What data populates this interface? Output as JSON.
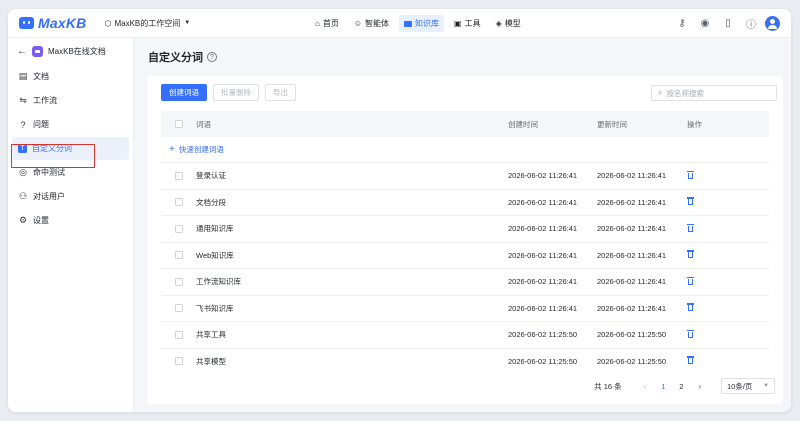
{
  "app": {
    "name": "MaxKB"
  },
  "workspace": {
    "label": "MaxKB的工作空间"
  },
  "nav": [
    {
      "label": "首页",
      "icon": "home-icon",
      "active": false
    },
    {
      "label": "智能体",
      "icon": "robot-icon",
      "active": false
    },
    {
      "label": "知识库",
      "icon": "book-icon",
      "active": true
    },
    {
      "label": "工具",
      "icon": "toolbox-icon",
      "active": false
    },
    {
      "label": "模型",
      "icon": "cube-icon",
      "active": false
    }
  ],
  "top_icons": [
    "key-icon",
    "github-icon",
    "document-icon",
    "help-icon",
    "user-avatar-icon"
  ],
  "sidebar": {
    "kb_name": "MaxKB在线文档",
    "items": [
      {
        "label": "文档",
        "icon": "document-icon",
        "active": false
      },
      {
        "label": "工作流",
        "icon": "workflow-icon",
        "active": false
      },
      {
        "label": "问题",
        "icon": "question-icon",
        "active": false
      },
      {
        "label": "自定义分词",
        "icon": "text-t-icon",
        "active": true
      },
      {
        "label": "命中测试",
        "icon": "target-icon",
        "active": false
      },
      {
        "label": "对话用户",
        "icon": "users-icon",
        "active": false
      },
      {
        "label": "设置",
        "icon": "gear-icon",
        "active": false
      }
    ]
  },
  "page": {
    "title": "自定义分词",
    "toolbar": {
      "create": "创建词语",
      "batch_delete": "批量删除",
      "export": "导出"
    },
    "search": {
      "placeholder": "按名称搜索"
    },
    "table": {
      "headers": {
        "word": "词语",
        "created": "创建时间",
        "updated": "更新时间",
        "ops": "操作"
      },
      "quick_create": "快速创建词语",
      "rows": [
        {
          "word": "登录认证",
          "created": "2026-06-02 11:26:41",
          "updated": "2026-06-02 11:26:41"
        },
        {
          "word": "文档分段",
          "created": "2026-06-02 11:26:41",
          "updated": "2026-06-02 11:26:41"
        },
        {
          "word": "通用知识库",
          "created": "2026-06-02 11:26:41",
          "updated": "2026-06-02 11:26:41"
        },
        {
          "word": "Web知识库",
          "created": "2026-06-02 11:26:41",
          "updated": "2026-06-02 11:26:41"
        },
        {
          "word": "工作流知识库",
          "created": "2026-06-02 11:26:41",
          "updated": "2026-06-02 11:26:41"
        },
        {
          "word": "飞书知识库",
          "created": "2026-06-02 11:26:41",
          "updated": "2026-06-02 11:26:41"
        },
        {
          "word": "共享工具",
          "created": "2026-06-02 11:25:50",
          "updated": "2026-06-02 11:25:50"
        },
        {
          "word": "共享模型",
          "created": "2026-06-02 11:25:50",
          "updated": "2026-06-02 11:25:50"
        }
      ]
    },
    "pagination": {
      "total": "共 16 条",
      "pages": [
        "1",
        "2"
      ],
      "current": "1",
      "page_size": "10条/页"
    }
  },
  "colors": {
    "accent": "#3370ff",
    "highlight": "#d9362b",
    "kb_badge": "#7b5cf0"
  }
}
